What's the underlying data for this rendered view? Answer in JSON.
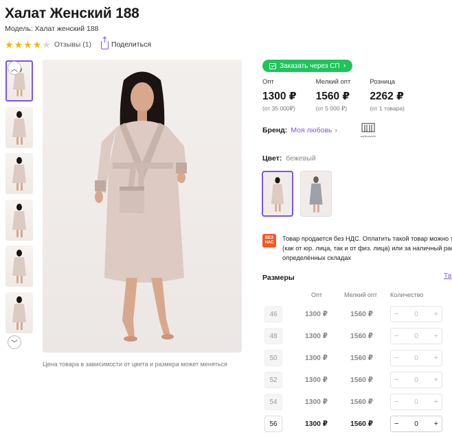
{
  "product": {
    "title": "Халат Женский 188",
    "model": "Модель: Халат женский 188",
    "rating_stars": 4,
    "rating_max": 5,
    "reviews": "Отзывы (1)",
    "share": "Поделиться"
  },
  "image_note": "Цена товара в зависимости от цвета и размера может меняться",
  "order_button": "Заказать через СП",
  "prices": [
    {
      "label": "Опт",
      "value": "1300 ₽",
      "sub": "(от 35 000₽)"
    },
    {
      "label": "Мелкий опт",
      "value": "1560 ₽",
      "sub": "(от 5 000 ₽)"
    },
    {
      "label": "Розница",
      "value": "2262 ₽",
      "sub": "(от 1 товара)"
    }
  ],
  "brand": {
    "label": "Бренд:",
    "name": "Моя любовь",
    "logo_text": "mylovestyle"
  },
  "color": {
    "label": "Цвет:",
    "value": "бежевый"
  },
  "vat": {
    "badge_line1": "БЕЗ",
    "badge_line2": "НАС",
    "line1": "Товар продается без НДС. Оплатить такой товар можно т",
    "line2": "(как от юр. лица, так и от физ. лица) или за наличный рас",
    "line3": "определённых складах"
  },
  "sizes": {
    "title": "Размеры",
    "table_link": "Та",
    "headers": {
      "opt": "Опт",
      "small": "Мелкий опт",
      "qty": "Количество"
    },
    "rows": [
      {
        "size": "46",
        "opt": "1300 ₽",
        "small": "1560 ₽",
        "qty": "0",
        "available": false
      },
      {
        "size": "48",
        "opt": "1300 ₽",
        "small": "1560 ₽",
        "qty": "0",
        "available": false
      },
      {
        "size": "50",
        "opt": "1300 ₽",
        "small": "1560 ₽",
        "qty": "0",
        "available": false
      },
      {
        "size": "52",
        "opt": "1300 ₽",
        "small": "1560 ₽",
        "qty": "0",
        "available": false
      },
      {
        "size": "54",
        "opt": "1300 ₽",
        "small": "1560 ₽",
        "qty": "0",
        "available": false
      },
      {
        "size": "56",
        "opt": "1300 ₽",
        "small": "1560 ₽",
        "qty": "0",
        "available": true
      }
    ]
  },
  "colors": {
    "accent": "#7b55e0",
    "green": "#1ec45a",
    "star": "#f7b500",
    "badge": "#f15a24"
  }
}
